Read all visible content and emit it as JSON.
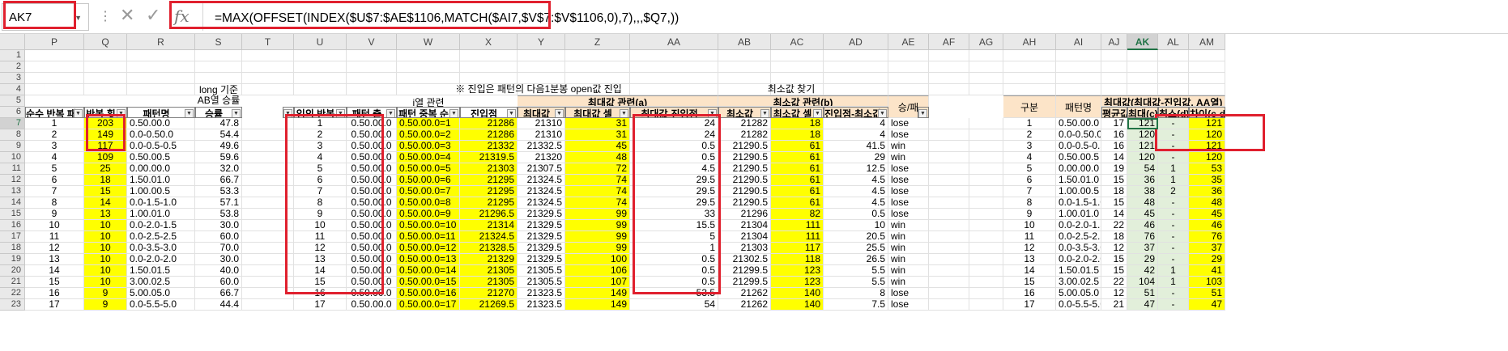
{
  "name_box": "AK7",
  "formula": "=MAX(OFFSET(INDEX($U$7:$AE$1106,MATCH($AI7,$V$7:$V$1106,0),7),,,$Q7,))",
  "columns": [
    "P",
    "Q",
    "R",
    "S",
    "T",
    "U",
    "V",
    "W",
    "X",
    "Y",
    "Z",
    "AA",
    "AB",
    "AC",
    "AD",
    "AE",
    "AF",
    "AG",
    "AH",
    "AI",
    "AJ",
    "AK",
    "AL",
    "AM"
  ],
  "rows": [
    "1",
    "2",
    "3",
    "4",
    "5",
    "6",
    "7",
    "8",
    "9",
    "10",
    "11",
    "12",
    "13",
    "14",
    "15",
    "16",
    "17",
    "18",
    "19",
    "20",
    "21",
    "22",
    "23"
  ],
  "notes": {
    "long_basis_1": "long 기준",
    "long_basis_2": "AB열 승률",
    "i_col": "i열 관련",
    "entry_rule": "※ 진입은 패턴의 다음1분봉 open값 진입",
    "min_find": "최소값 찾기",
    "max_rel": "최대값 관련(a)",
    "min_rel": "최소값 관련(b)",
    "win_loss": "승/패",
    "group": "구분",
    "pattern_name": "패턴명",
    "maxv_title": "최대값(최대값-진입값, AA열)"
  },
  "headers": {
    "P": "순수 반복 패",
    "Q": "반복 횟",
    "R": "패턴명",
    "S": "승률",
    "U": "임의 반복",
    "V": "패턴 출",
    "W": "패턴 중복 순",
    "X": "진입점",
    "Y": "최대값",
    "Z": "최대값 셀",
    "AA": "최대값-진입점",
    "AB": "최소값",
    "AC": "최소값 셀",
    "AD": "진입점-최소값",
    "AJ": "평균값",
    "AK": "최대(c)",
    "AL": "최소(d)",
    "AM": "차이(c-d)"
  },
  "rows_data": [
    [
      "1",
      "203",
      "0.50.00.0",
      "47.8",
      "1",
      "0.50.00.0",
      "0.50.00.0=1",
      "21286",
      "21310",
      "31",
      "24",
      "21282",
      "18",
      "4",
      "lose",
      "1",
      "0.50.00.0",
      "17",
      "121",
      "-",
      "121"
    ],
    [
      "2",
      "149",
      "0.0-0.50.0",
      "54.4",
      "2",
      "0.50.00.0",
      "0.50.00.0=2",
      "21286",
      "21310",
      "31",
      "24",
      "21282",
      "18",
      "4",
      "lose",
      "2",
      "0.0-0.50.0",
      "16",
      "120",
      "-",
      "120"
    ],
    [
      "3",
      "117",
      "0.0-0.5-0.5",
      "49.6",
      "3",
      "0.50.00.0",
      "0.50.00.0=3",
      "21332",
      "21332.5",
      "45",
      "0.5",
      "21290.5",
      "61",
      "41.5",
      "win",
      "3",
      "0.0-0.5-0.5",
      "16",
      "121",
      "-",
      "121"
    ],
    [
      "4",
      "109",
      "0.50.00.5",
      "59.6",
      "4",
      "0.50.00.0",
      "0.50.00.0=4",
      "21319.5",
      "21320",
      "48",
      "0.5",
      "21290.5",
      "61",
      "29",
      "win",
      "4",
      "0.50.00.5",
      "14",
      "120",
      "-",
      "120"
    ],
    [
      "5",
      "25",
      "0.00.00.0",
      "32.0",
      "5",
      "0.50.00.0",
      "0.50.00.0=5",
      "21303",
      "21307.5",
      "72",
      "4.5",
      "21290.5",
      "61",
      "12.5",
      "lose",
      "5",
      "0.00.00.0",
      "19",
      "54",
      "1",
      "53"
    ],
    [
      "6",
      "18",
      "1.50.01.0",
      "66.7",
      "6",
      "0.50.00.0",
      "0.50.00.0=6",
      "21295",
      "21324.5",
      "74",
      "29.5",
      "21290.5",
      "61",
      "4.5",
      "lose",
      "6",
      "1.50.01.0",
      "15",
      "36",
      "1",
      "35"
    ],
    [
      "7",
      "15",
      "1.00.00.5",
      "53.3",
      "7",
      "0.50.00.0",
      "0.50.00.0=7",
      "21295",
      "21324.5",
      "74",
      "29.5",
      "21290.5",
      "61",
      "4.5",
      "lose",
      "7",
      "1.00.00.5",
      "18",
      "38",
      "2",
      "36"
    ],
    [
      "8",
      "14",
      "0.0-1.5-1.0",
      "57.1",
      "8",
      "0.50.00.0",
      "0.50.00.0=8",
      "21295",
      "21324.5",
      "74",
      "29.5",
      "21290.5",
      "61",
      "4.5",
      "lose",
      "8",
      "0.0-1.5-1.0",
      "15",
      "48",
      "-",
      "48"
    ],
    [
      "9",
      "13",
      "1.00.01.0",
      "53.8",
      "9",
      "0.50.00.0",
      "0.50.00.0=9",
      "21296.5",
      "21329.5",
      "99",
      "33",
      "21296",
      "82",
      "0.5",
      "lose",
      "9",
      "1.00.01.0",
      "14",
      "45",
      "-",
      "45"
    ],
    [
      "10",
      "10",
      "0.0-2.0-1.5",
      "30.0",
      "10",
      "0.50.00.0",
      "0.50.00.0=10",
      "21314",
      "21329.5",
      "99",
      "15.5",
      "21304",
      "111",
      "10",
      "win",
      "10",
      "0.0-2.0-1.5",
      "22",
      "46",
      "-",
      "46"
    ],
    [
      "11",
      "10",
      "0.0-2.5-2.5",
      "60.0",
      "11",
      "0.50.00.0",
      "0.50.00.0=11",
      "21324.5",
      "21329.5",
      "99",
      "5",
      "21304",
      "111",
      "20.5",
      "win",
      "11",
      "0.0-2.5-2.5",
      "18",
      "76",
      "-",
      "76"
    ],
    [
      "12",
      "10",
      "0.0-3.5-3.0",
      "70.0",
      "12",
      "0.50.00.0",
      "0.50.00.0=12",
      "21328.5",
      "21329.5",
      "99",
      "1",
      "21303",
      "117",
      "25.5",
      "win",
      "12",
      "0.0-3.5-3.0",
      "12",
      "37",
      "-",
      "37"
    ],
    [
      "13",
      "10",
      "0.0-2.0-2.0",
      "30.0",
      "13",
      "0.50.00.0",
      "0.50.00.0=13",
      "21329",
      "21329.5",
      "100",
      "0.5",
      "21302.5",
      "118",
      "26.5",
      "win",
      "13",
      "0.0-2.0-2.0",
      "15",
      "29",
      "-",
      "29"
    ],
    [
      "14",
      "10",
      "1.50.01.5",
      "40.0",
      "14",
      "0.50.00.0",
      "0.50.00.0=14",
      "21305",
      "21305.5",
      "106",
      "0.5",
      "21299.5",
      "123",
      "5.5",
      "win",
      "14",
      "1.50.01.5",
      "15",
      "42",
      "1",
      "41"
    ],
    [
      "15",
      "10",
      "3.00.02.5",
      "60.0",
      "15",
      "0.50.00.0",
      "0.50.00.0=15",
      "21305",
      "21305.5",
      "107",
      "0.5",
      "21299.5",
      "123",
      "5.5",
      "win",
      "15",
      "3.00.02.5",
      "22",
      "104",
      "1",
      "103"
    ],
    [
      "16",
      "9",
      "5.00.05.0",
      "66.7",
      "16",
      "0.50.00.0",
      "0.50.00.0=16",
      "21270",
      "21323.5",
      "149",
      "53.5",
      "21262",
      "140",
      "8",
      "lose",
      "16",
      "5.00.05.0",
      "12",
      "51",
      "-",
      "51"
    ],
    [
      "17",
      "9",
      "0.0-5.5-5.0",
      "44.4",
      "17",
      "0.50.00.0",
      "0.50.00.0=17",
      "21269.5",
      "21323.5",
      "149",
      "54",
      "21262",
      "140",
      "7.5",
      "lose",
      "17",
      "0.0-5.5-5.0",
      "21",
      "47",
      "-",
      "47"
    ]
  ]
}
